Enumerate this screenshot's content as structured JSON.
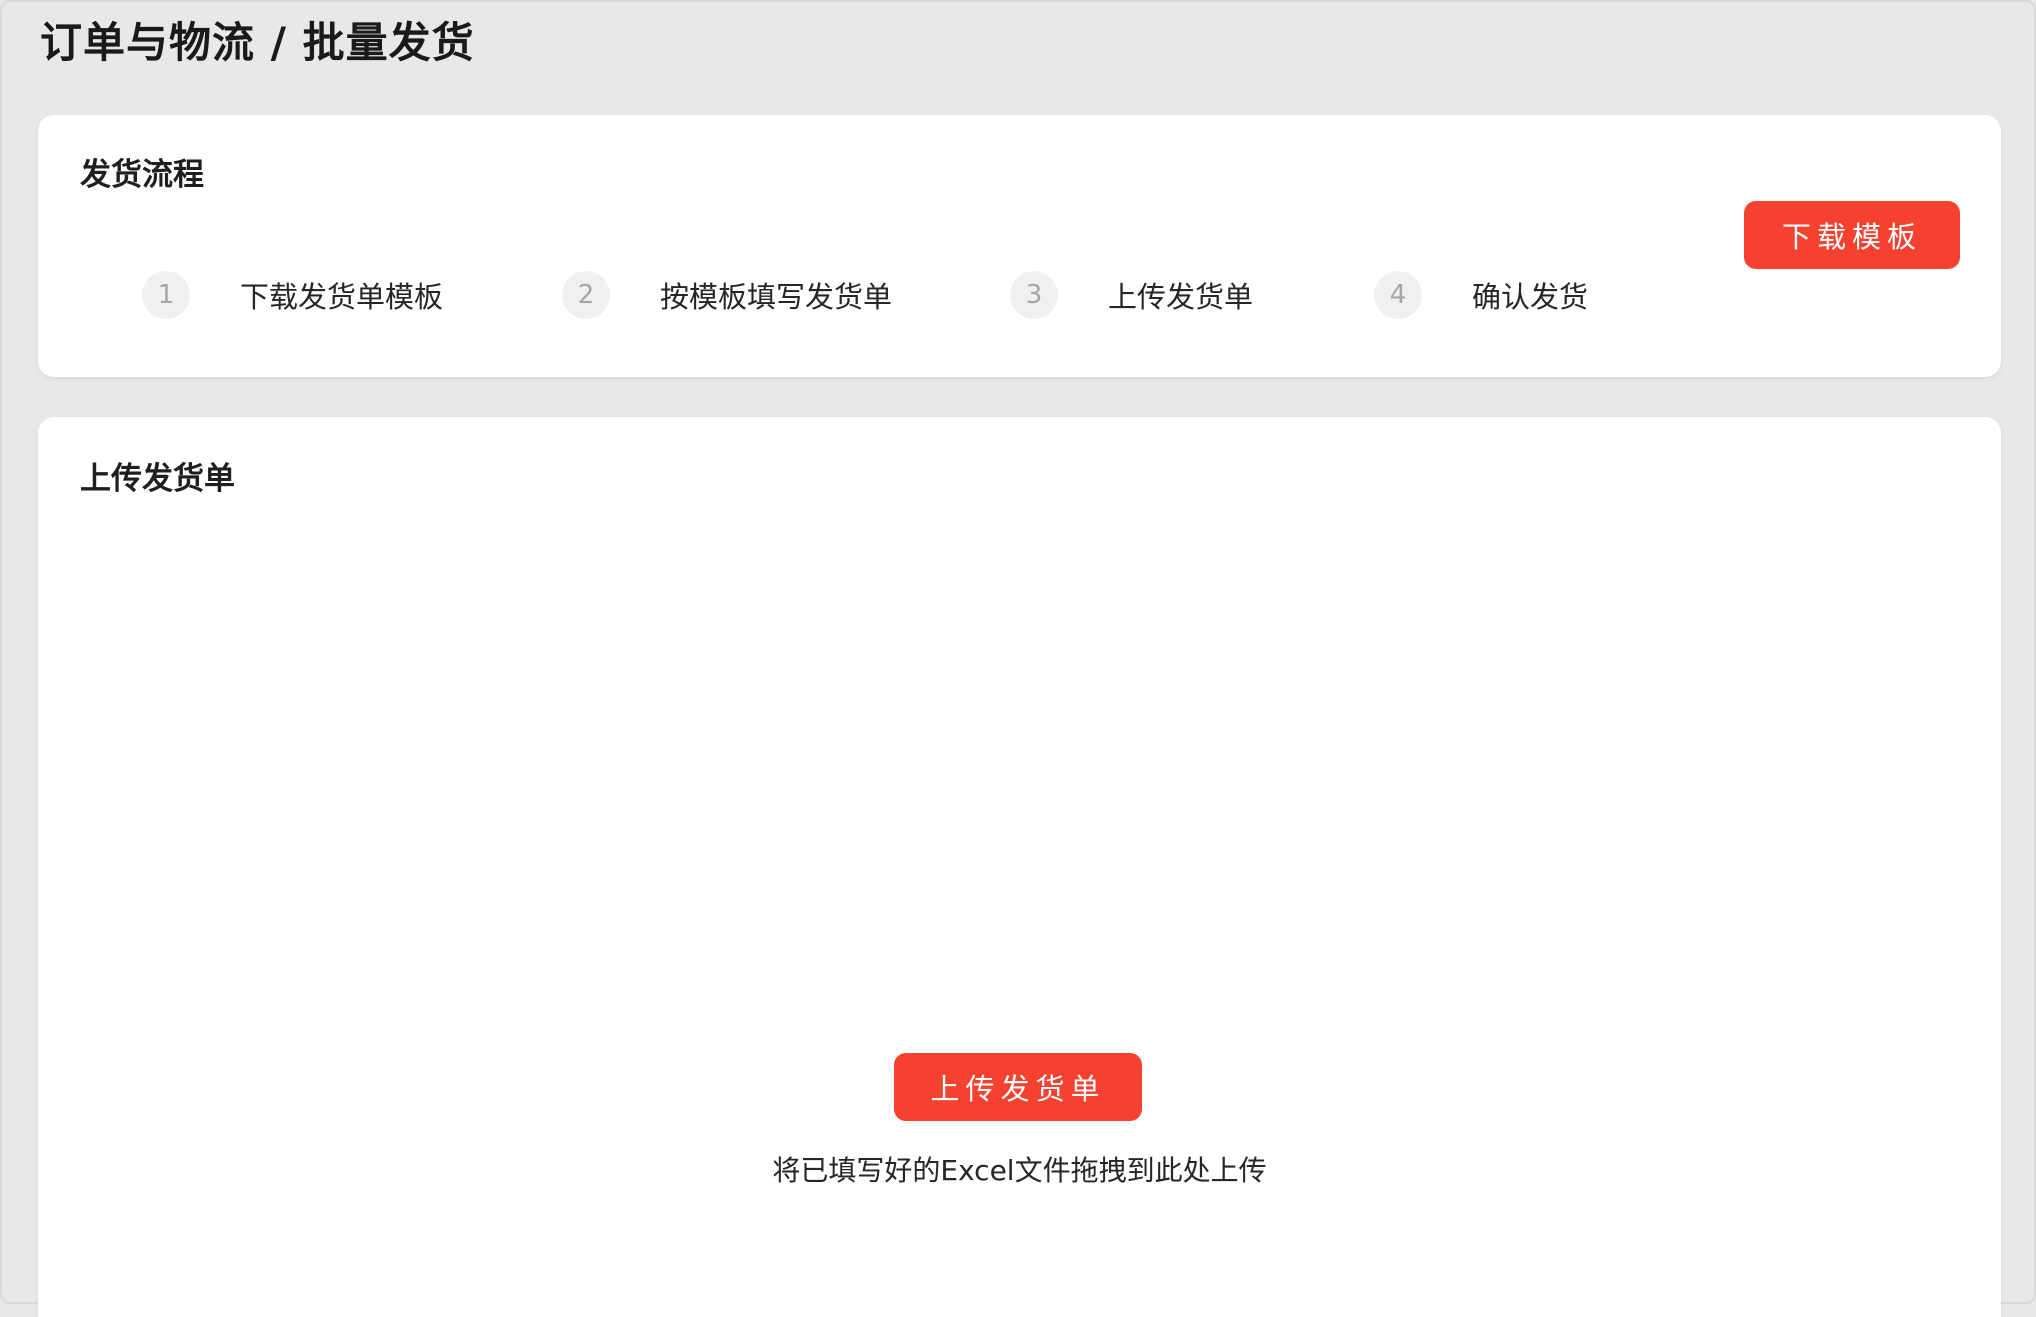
{
  "header": {
    "breadcrumb_title": "订单与物流 / 批量发货"
  },
  "process_card": {
    "title": "发货流程",
    "download_button_label": "下载模板",
    "steps": [
      {
        "number": "1",
        "label": "下载发货单模板"
      },
      {
        "number": "2",
        "label": "按模板填写发货单"
      },
      {
        "number": "3",
        "label": "上传发货单"
      },
      {
        "number": "4",
        "label": "确认发货"
      }
    ]
  },
  "upload_card": {
    "title": "上传发货单",
    "upload_button_label": "上传发货单",
    "hint": "将已填写好的Excel文件拖拽到此处上传"
  },
  "colors": {
    "accent": "#f5412f",
    "page_background": "#e8e8e8",
    "card_background": "#ffffff",
    "step_circle": "#f0f0f0"
  }
}
